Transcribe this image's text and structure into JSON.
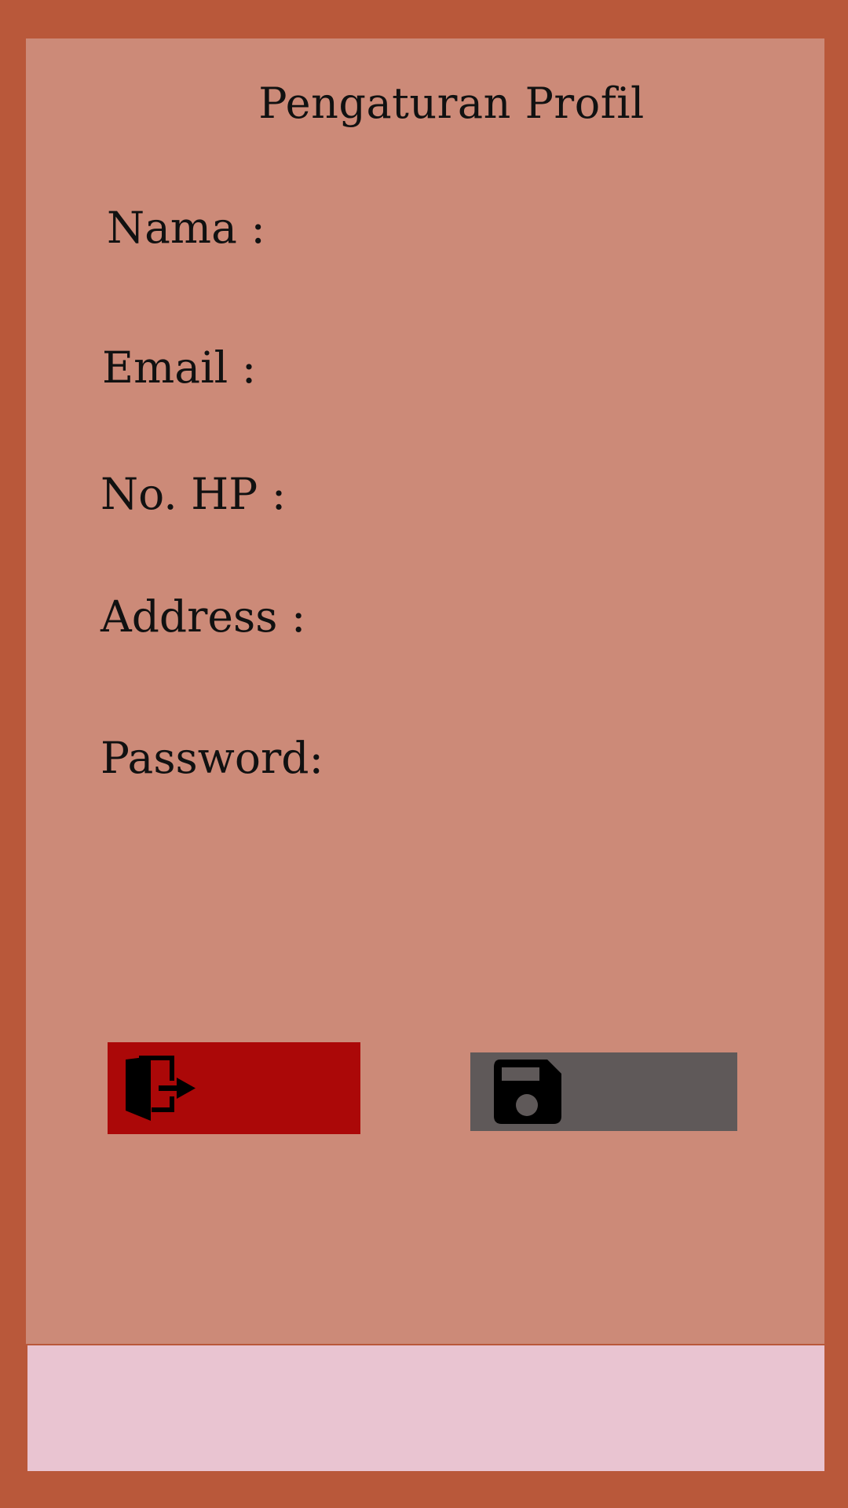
{
  "colors": {
    "background": "#b9583a",
    "panel": "#cc8a78",
    "footer_bar": "#e9c4d1",
    "logout_button": "#ab0808",
    "save_button": "#5f5959"
  },
  "header": {
    "title": "Pengaturan Profil"
  },
  "form": {
    "name_label": "Nama :",
    "email_label": "Email :",
    "phone_label": "No. HP :",
    "address_label": "Address :",
    "password_label": "Password:"
  },
  "actions": {
    "logout_icon": "logout-door-icon",
    "save_icon": "save-floppy-icon"
  }
}
